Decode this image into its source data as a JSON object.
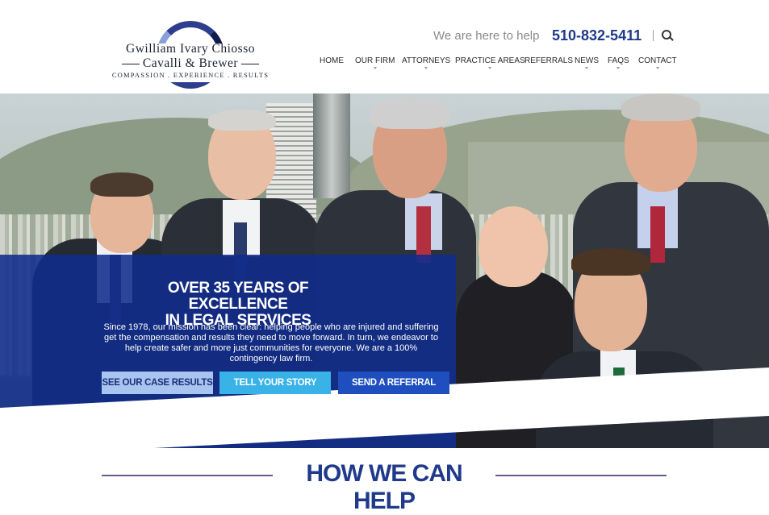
{
  "logo": {
    "line1": "Gwilliam Ivary Chiosso",
    "line2": "Cavalli & Brewer",
    "line3": "COMPASSION . EXPERIENCE . RESULTS"
  },
  "header": {
    "tagline": "We are here to help",
    "phone": "510-832-5411"
  },
  "nav": {
    "items": [
      {
        "label": "HOME"
      },
      {
        "label": "OUR FIRM"
      },
      {
        "label": "ATTORNEYS"
      },
      {
        "label": "PRACTICE AREAS"
      },
      {
        "label": "REFERRALS"
      },
      {
        "label": "NEWS"
      },
      {
        "label": "FAQS"
      },
      {
        "label": "CONTACT"
      }
    ]
  },
  "hero": {
    "title_line1": "OVER 35 YEARS OF EXCELLENCE",
    "title_line2": "IN LEGAL SERVICES",
    "text": "Since 1978, our mission has been clear: helping people who are injured and suffering get the compensation and results they need to move forward. In turn, we endeavor to help create safer and more just communities for everyone. We are a 100% contingency law firm.",
    "buttons": {
      "case_results": "SEE OUR CASE RESULTS",
      "tell_story": "TELL YOUR STORY",
      "referral": "SEND A REFERRAL"
    }
  },
  "section": {
    "title": "HOW WE CAN HELP"
  },
  "colors": {
    "brand_blue": "#1f3a8a",
    "overlay_blue": "#102c8c",
    "accent_light": "#a9c4ee",
    "accent_cyan": "#39b2e8"
  }
}
